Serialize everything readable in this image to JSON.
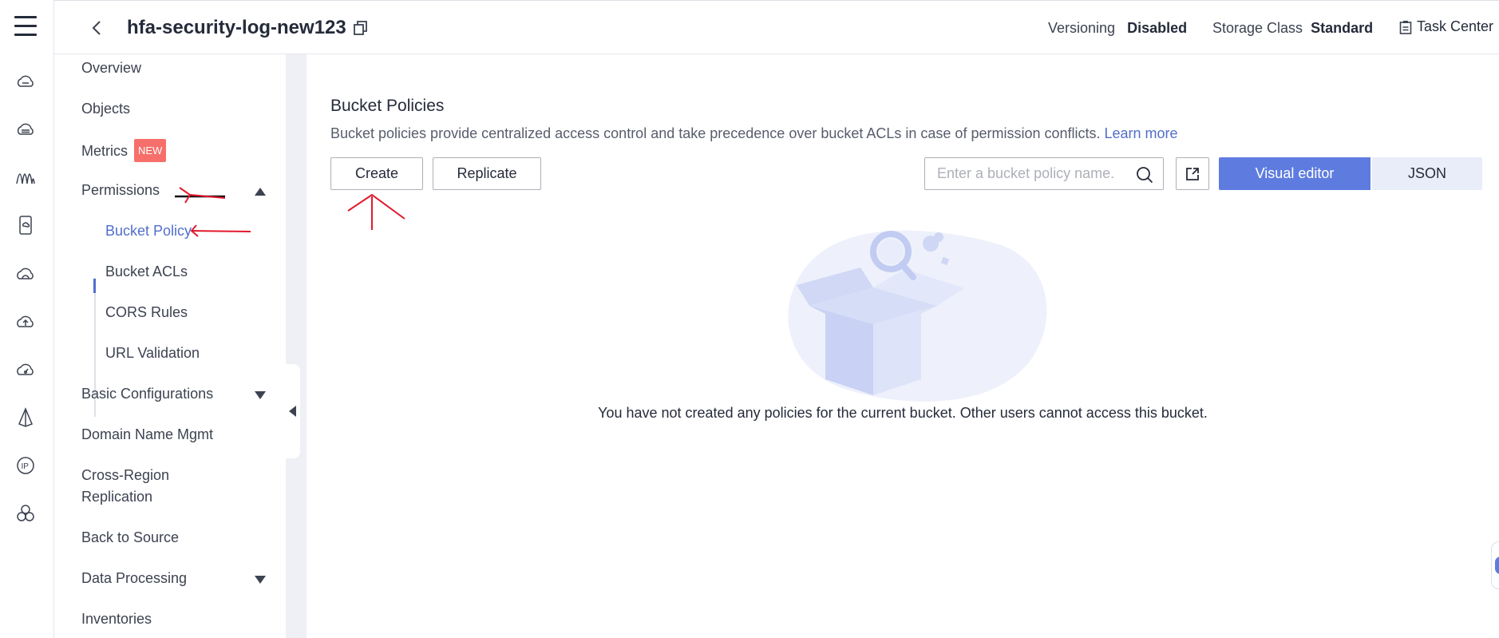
{
  "header": {
    "bucket_name": "hfa-security-log-new123",
    "versioning_label": "Versioning",
    "versioning_value": "Disabled",
    "storage_class_label": "Storage Class",
    "storage_class_value": "Standard",
    "task_center": "Task Center"
  },
  "rail": {
    "icons": [
      "cloud-server-icon",
      "cloud-disk-icon",
      "monitoring-icon",
      "cloud-phone-icon",
      "cloud-icon",
      "cloud-upload-icon",
      "cloud-dashboard-icon",
      "network-icon",
      "ip-icon",
      "cluster-icon"
    ]
  },
  "sidenav": {
    "items": {
      "overview": "Overview",
      "objects": "Objects",
      "metrics": "Metrics",
      "metrics_badge": "NEW",
      "permissions": "Permissions",
      "bucket_policy": "Bucket Policy",
      "bucket_acls": "Bucket ACLs",
      "cors_rules": "CORS Rules",
      "url_validation": "URL Validation",
      "basic_configurations": "Basic Configurations",
      "domain_name_mgmt": "Domain Name Mgmt",
      "cross_region_1": "Cross-Region",
      "cross_region_2": "Replication",
      "back_to_source": "Back to Source",
      "data_processing": "Data Processing",
      "inventories": "Inventories"
    }
  },
  "main": {
    "title": "Bucket Policies",
    "description": "Bucket policies provide centralized access control and take precedence over bucket ACLs in case of permission conflicts.",
    "learn_more": "Learn more",
    "create_label": "Create",
    "replicate_label": "Replicate",
    "search_placeholder": "Enter a bucket policy name.",
    "visual_editor_label": "Visual editor",
    "json_label": "JSON",
    "empty_message": "You have not created any policies for the current bucket. Other users cannot access this bucket."
  },
  "colors": {
    "accent": "#5e7ce0",
    "active_link": "#526ecc",
    "badge_new": "#f66f6a",
    "annotation": "#e0182d"
  }
}
